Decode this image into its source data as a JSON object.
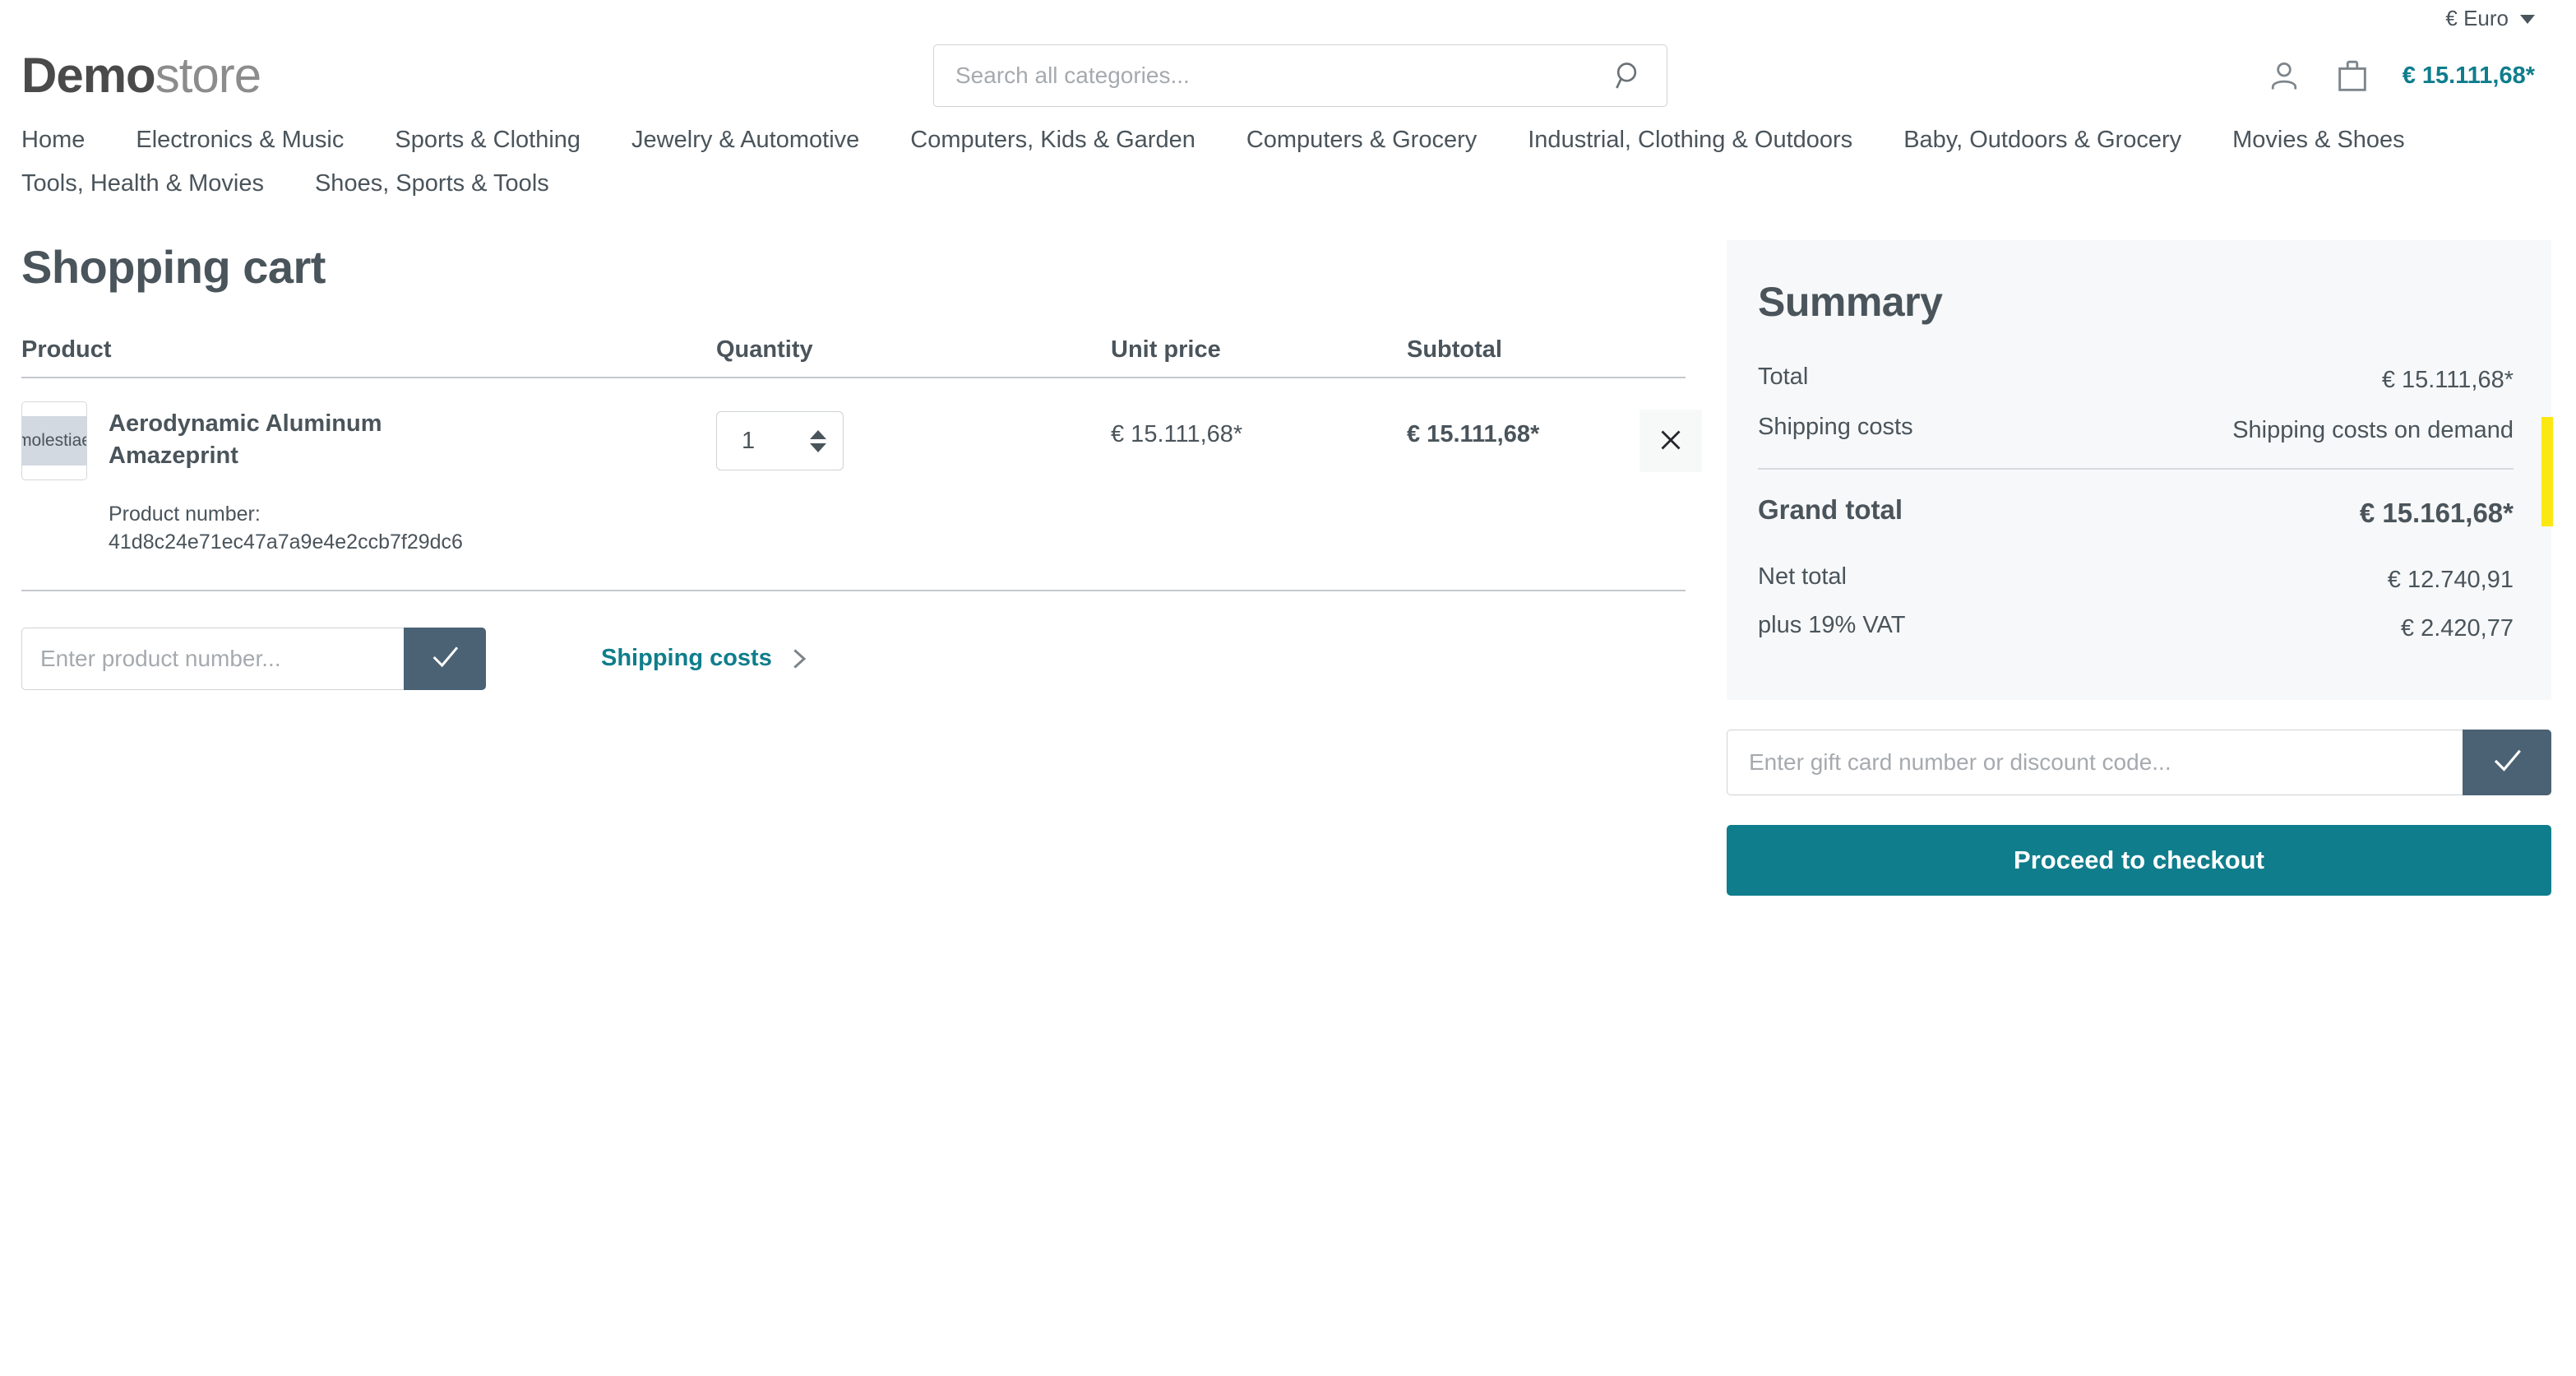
{
  "topbar": {
    "currency_label": "€ Euro"
  },
  "header": {
    "logo_bold": "Demo",
    "logo_light": "store",
    "search_placeholder": "Search all categories...",
    "cart_total": "€ 15.111,68*"
  },
  "nav": {
    "items": [
      {
        "label": "Home"
      },
      {
        "label": "Electronics & Music"
      },
      {
        "label": "Sports & Clothing"
      },
      {
        "label": "Jewelry & Automotive"
      },
      {
        "label": "Computers, Kids & Garden"
      },
      {
        "label": "Computers & Grocery"
      },
      {
        "label": "Industrial, Clothing & Outdoors"
      },
      {
        "label": "Baby, Outdoors & Grocery"
      },
      {
        "label": "Movies & Shoes"
      },
      {
        "label": "Tools, Health & Movies"
      },
      {
        "label": "Shoes, Sports & Tools"
      }
    ]
  },
  "cart": {
    "page_title": "Shopping cart",
    "columns": {
      "product": "Product",
      "quantity": "Quantity",
      "unit_price": "Unit price",
      "subtotal": "Subtotal"
    },
    "items": [
      {
        "thumb_text": "molestiae",
        "name": "Aerodynamic Aluminum Amazeprint",
        "product_number_label": "Product number:",
        "product_number": "41d8c24e71ec47a7a9e4e2ccb7f29dc6",
        "quantity": "1",
        "unit_price": "€ 15.111,68*",
        "subtotal": "€ 15.111,68*"
      }
    ],
    "add_product_placeholder": "Enter product number...",
    "shipping_costs_link": "Shipping costs"
  },
  "summary": {
    "title": "Summary",
    "total_label": "Total",
    "total_value": "€ 15.111,68*",
    "shipping_label": "Shipping costs",
    "shipping_value": "Shipping costs on demand",
    "grand_total_label": "Grand total",
    "grand_total_value": "€ 15.161,68*",
    "net_total_label": "Net total",
    "net_total_value": "€ 12.740,91",
    "vat_label": "plus 19% VAT",
    "vat_value": "€ 2.420,77",
    "discount_placeholder": "Enter gift card number or discount code...",
    "checkout_label": "Proceed to checkout",
    "marker_color": "#fbe712"
  },
  "colors": {
    "accent_teal": "#0f7d8c",
    "slate": "#4a6274",
    "text": "#4a545b",
    "panel_bg": "#f7f8f9"
  }
}
